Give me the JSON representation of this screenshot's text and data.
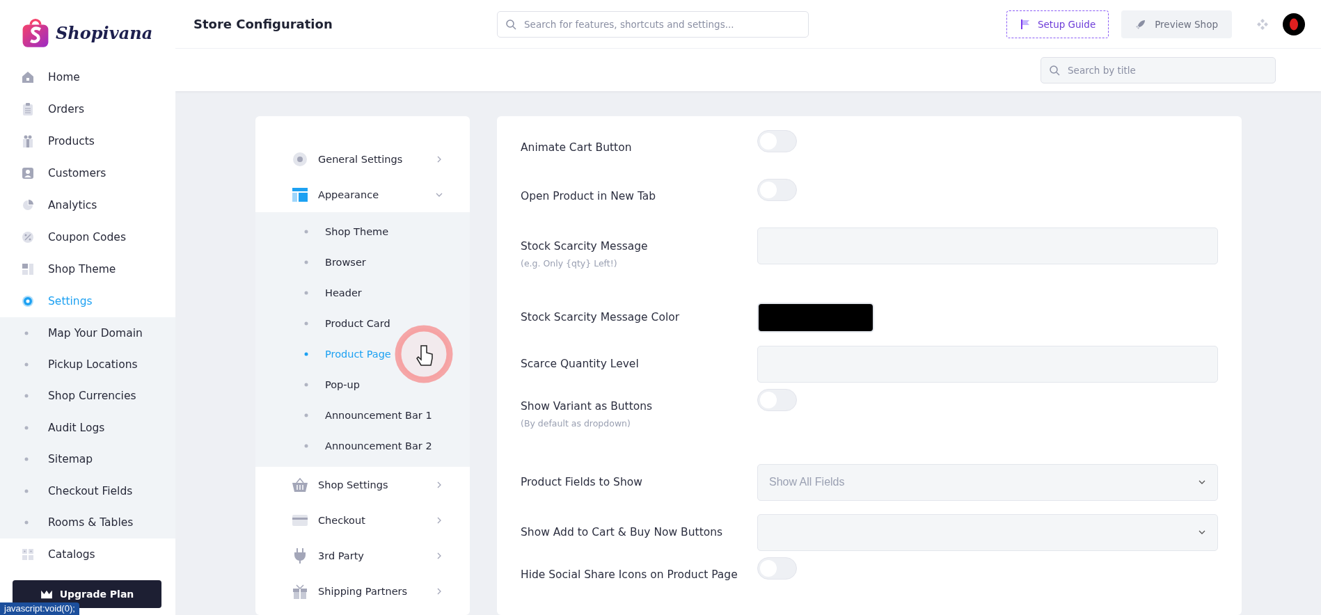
{
  "sidebar": {
    "logo": "Shopivana",
    "items": [
      {
        "label": "Home",
        "selected": false
      },
      {
        "label": "Orders",
        "selected": false
      },
      {
        "label": "Products",
        "selected": false
      },
      {
        "label": "Customers",
        "selected": false
      },
      {
        "label": "Analytics",
        "selected": false
      },
      {
        "label": "Coupon Codes",
        "selected": false
      },
      {
        "label": "Shop Theme",
        "selected": false
      },
      {
        "label": "Settings",
        "selected": true,
        "expanded": true,
        "children": [
          {
            "label": "Map Your Domain",
            "selected": false
          },
          {
            "label": "Pickup Locations",
            "selected": false
          },
          {
            "label": "Shop Currencies",
            "selected": false
          },
          {
            "label": "Audit Logs",
            "selected": false
          },
          {
            "label": "Sitemap",
            "selected": false
          },
          {
            "label": "Checkout Fields",
            "selected": false
          },
          {
            "label": "Rooms & Tables",
            "selected": false
          }
        ]
      },
      {
        "label": "Catalogs",
        "selected": false
      }
    ],
    "upgrade_button": "Upgrade Plan"
  },
  "header": {
    "title": "Store Configuration",
    "search": {
      "placeholder": "Search for features, shortcuts and settings..."
    },
    "setup_guide": "Setup Guide",
    "preview_shop": "Preview Shop"
  },
  "subheader": {
    "search": {
      "placeholder": "Search by title"
    }
  },
  "settings_nav": [
    {
      "label": "General Settings",
      "expanded": false
    },
    {
      "label": "Appearance",
      "expanded": true,
      "children": [
        {
          "label": "Shop Theme",
          "selected": false
        },
        {
          "label": "Browser",
          "selected": false
        },
        {
          "label": "Header",
          "selected": false
        },
        {
          "label": "Product Card",
          "selected": false
        },
        {
          "label": "Product Page",
          "selected": true
        },
        {
          "label": "Pop-up",
          "selected": false
        },
        {
          "label": "Announcement Bar 1",
          "selected": false
        },
        {
          "label": "Announcement Bar 2",
          "selected": false
        }
      ]
    },
    {
      "label": "Shop Settings",
      "expanded": false
    },
    {
      "label": "Checkout",
      "expanded": false
    },
    {
      "label": "3rd Party",
      "expanded": false
    },
    {
      "label": "Shipping Partners",
      "expanded": false
    }
  ],
  "form": [
    {
      "kind": "toggle",
      "label": "Animate Cart Button",
      "on": false
    },
    {
      "kind": "toggle",
      "label": "Open Product in New Tab",
      "on": false
    },
    {
      "kind": "text",
      "label": "Stock Scarcity Message",
      "hint": "(e.g. Only {qty} Left!)"
    },
    {
      "kind": "color",
      "label": "Stock Scarcity Message Color",
      "color": "#000000"
    },
    {
      "kind": "text",
      "label": "Scarce Quantity Level"
    },
    {
      "kind": "toggle",
      "label": "Show Variant as Buttons",
      "hint": "(By default as dropdown)",
      "on": false
    },
    {
      "kind": "select",
      "label": "Product Fields to Show",
      "placeholder": "Show All Fields"
    },
    {
      "kind": "select",
      "label": "Show Add to Cart & Buy Now Buttons"
    },
    {
      "kind": "toggle",
      "label": "Hide Social Share Icons on Product Page",
      "on": false
    }
  ],
  "status_tooltip": "javascript:void(0);"
}
